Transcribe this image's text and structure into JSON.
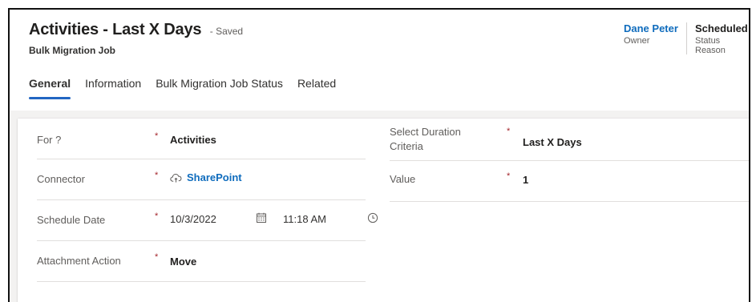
{
  "header": {
    "title": "Activities - Last X Days",
    "saved_status": "- Saved",
    "entity_type": "Bulk Migration Job",
    "owner": {
      "value": "Dane Peter",
      "label": "Owner"
    },
    "status_reason": {
      "value": "Scheduled",
      "label": "Status Reason"
    }
  },
  "tabs": [
    {
      "label": "General",
      "active": true
    },
    {
      "label": "Information",
      "active": false
    },
    {
      "label": "Bulk Migration Job Status",
      "active": false
    },
    {
      "label": "Related",
      "active": false
    }
  ],
  "form": {
    "left": {
      "for": {
        "label": "For ?",
        "required": "*",
        "value": "Activities"
      },
      "connector": {
        "label": "Connector",
        "required": "*",
        "value": "SharePoint",
        "icon": "cloud-icon"
      },
      "schedule_date": {
        "label": "Schedule Date",
        "required": "*",
        "date": "10/3/2022",
        "time": "11:18 AM",
        "date_icon": "calendar-icon",
        "time_icon": "clock-icon"
      },
      "attachment_action": {
        "label": "Attachment Action",
        "required": "*",
        "value": "Move"
      }
    },
    "right": {
      "duration_criteria": {
        "label_line1": "Select Duration",
        "label_line2": "Criteria",
        "required": "*",
        "value": "Last X Days"
      },
      "value": {
        "label": "Value",
        "required": "*",
        "value": "1"
      }
    }
  },
  "colors": {
    "accent_tab": "#2266c2",
    "link": "#0f6cbd",
    "required": "#a4262c"
  }
}
